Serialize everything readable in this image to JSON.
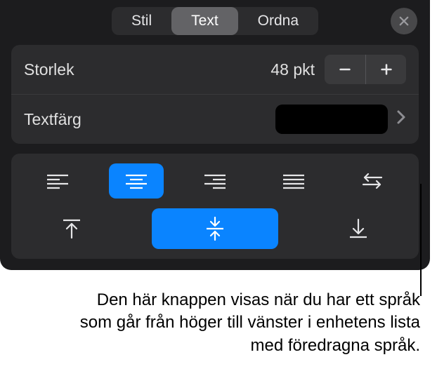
{
  "tabs": {
    "stil": "Stil",
    "text": "Text",
    "ordna": "Ordna"
  },
  "size": {
    "label": "Storlek",
    "value": "48 pkt"
  },
  "color": {
    "label": "Textfärg",
    "value": "#000000"
  },
  "callout": "Den här knappen visas när du har ett språk som går från höger till vänster i enhetens lista med föredragna språk."
}
